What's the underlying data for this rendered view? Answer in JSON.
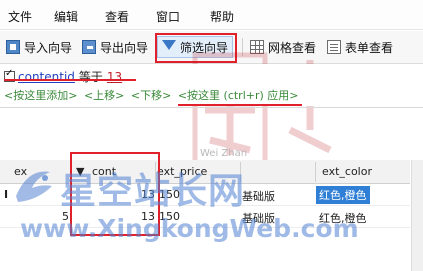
{
  "menubar": {
    "items": [
      "文件",
      "编辑",
      "查看",
      "窗口",
      "帮助"
    ]
  },
  "toolbar": {
    "import_label": "导入向导",
    "export_label": "导出向导",
    "filter_label": "筛选向导",
    "grid_label": "网格查看",
    "form_label": "表单查看"
  },
  "filter": {
    "field": "contentid",
    "operator": "等于",
    "value": "13",
    "hints": [
      "<按这里添加>",
      "<上移>",
      "<下移>",
      "<按这里 (ctrl+r) 应用>"
    ]
  },
  "watermark": {
    "sub_text": "Wei Zhan"
  },
  "grid": {
    "columns": [
      "ex",
      "cont",
      "ext_price",
      "",
      "ext_color"
    ],
    "rows": [
      {
        "marker": "I",
        "c1": "",
        "c2": "13",
        "c3": "150",
        "c4": "基础版",
        "c5": "红色,橙色",
        "selected": true
      },
      {
        "marker": "",
        "c1": "5",
        "c2": "13",
        "c3": "150",
        "c4": "基础版",
        "c5": "红色,橙色",
        "selected": false
      }
    ]
  },
  "brand": {
    "cn": "星空站长网",
    "en": "www.XingkongWeb.com"
  },
  "colors": {
    "highlight_red": "#e0202a",
    "selection_blue": "#2f7fd6",
    "hint_green": "#3a8a3a"
  }
}
